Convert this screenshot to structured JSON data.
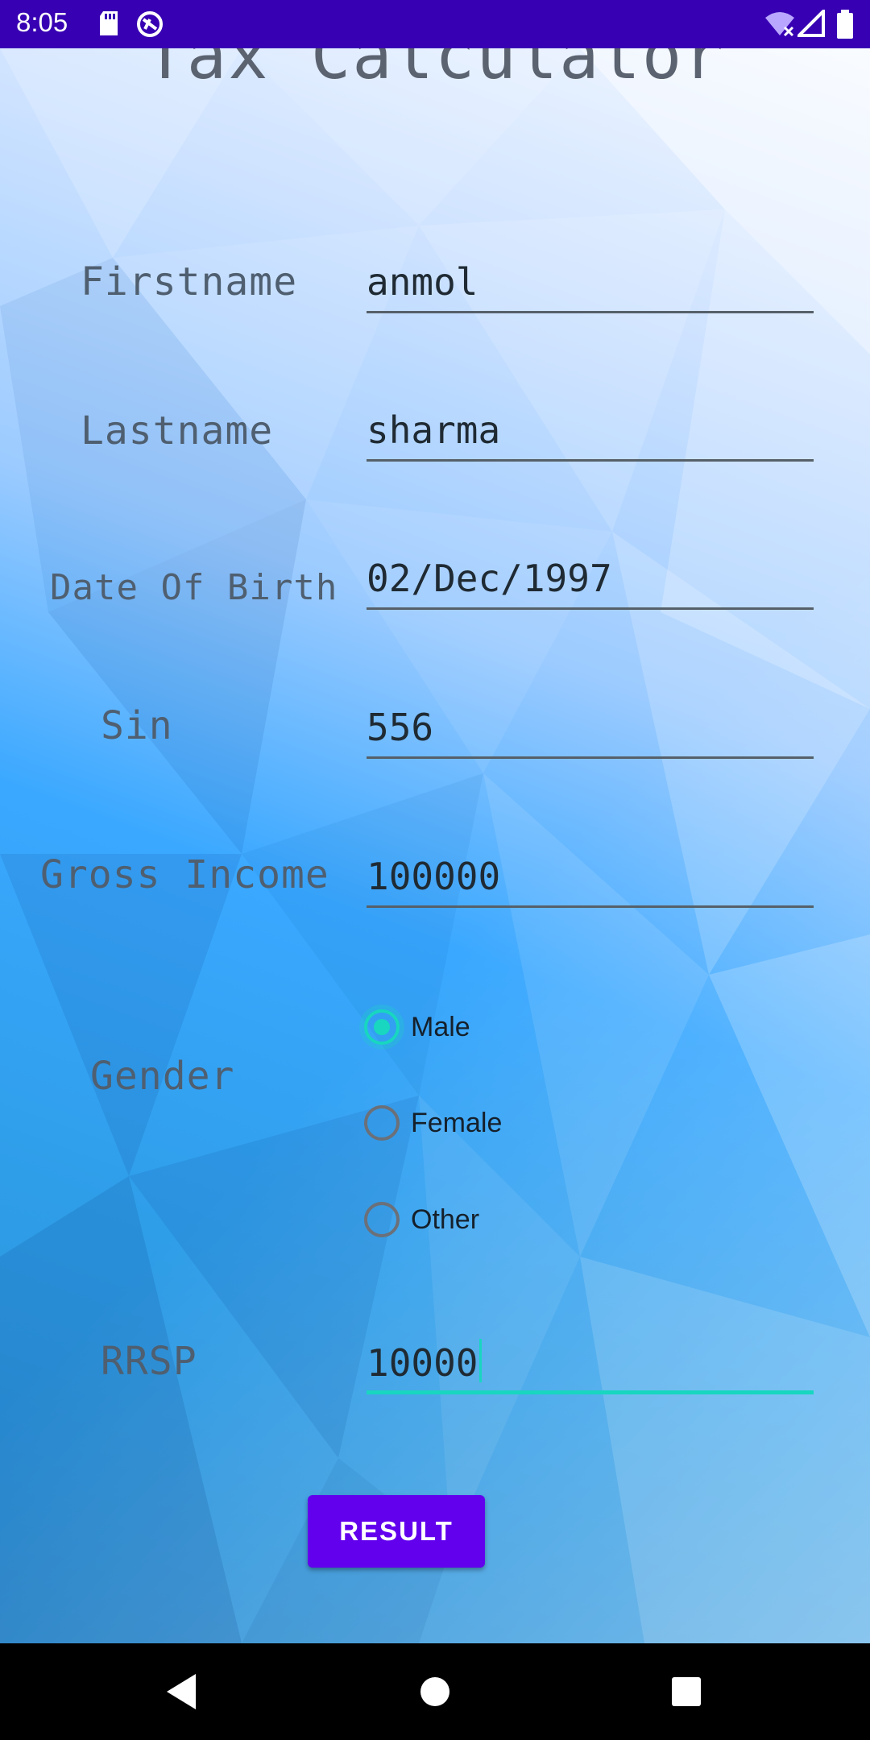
{
  "status_bar": {
    "time": "8:05",
    "icons": [
      "sd-card-icon",
      "sync-icon",
      "wifi-icon",
      "signal-icon",
      "battery-icon"
    ]
  },
  "form": {
    "title": "Tax Calculator",
    "fields": {
      "firstname": {
        "label": "Firstname",
        "value": "anmol"
      },
      "lastname": {
        "label": "Lastname",
        "value": "sharma"
      },
      "dob": {
        "label": "Date Of Birth",
        "value": "02/Dec/1997"
      },
      "sin": {
        "label": "Sin",
        "value": "556"
      },
      "income": {
        "label": "Gross Income",
        "value": "100000"
      },
      "rrsp": {
        "label": "RRSP",
        "value": "10000"
      }
    },
    "gender": {
      "label": "Gender",
      "options": [
        "Male",
        "Female",
        "Other"
      ],
      "selected": "Male"
    },
    "result_button": "RESULT"
  },
  "colors": {
    "status_bar": "#3700b3",
    "accent": "#18d6c0",
    "button": "#6200ee"
  },
  "nav": [
    "back-icon",
    "home-icon",
    "recents-icon"
  ]
}
